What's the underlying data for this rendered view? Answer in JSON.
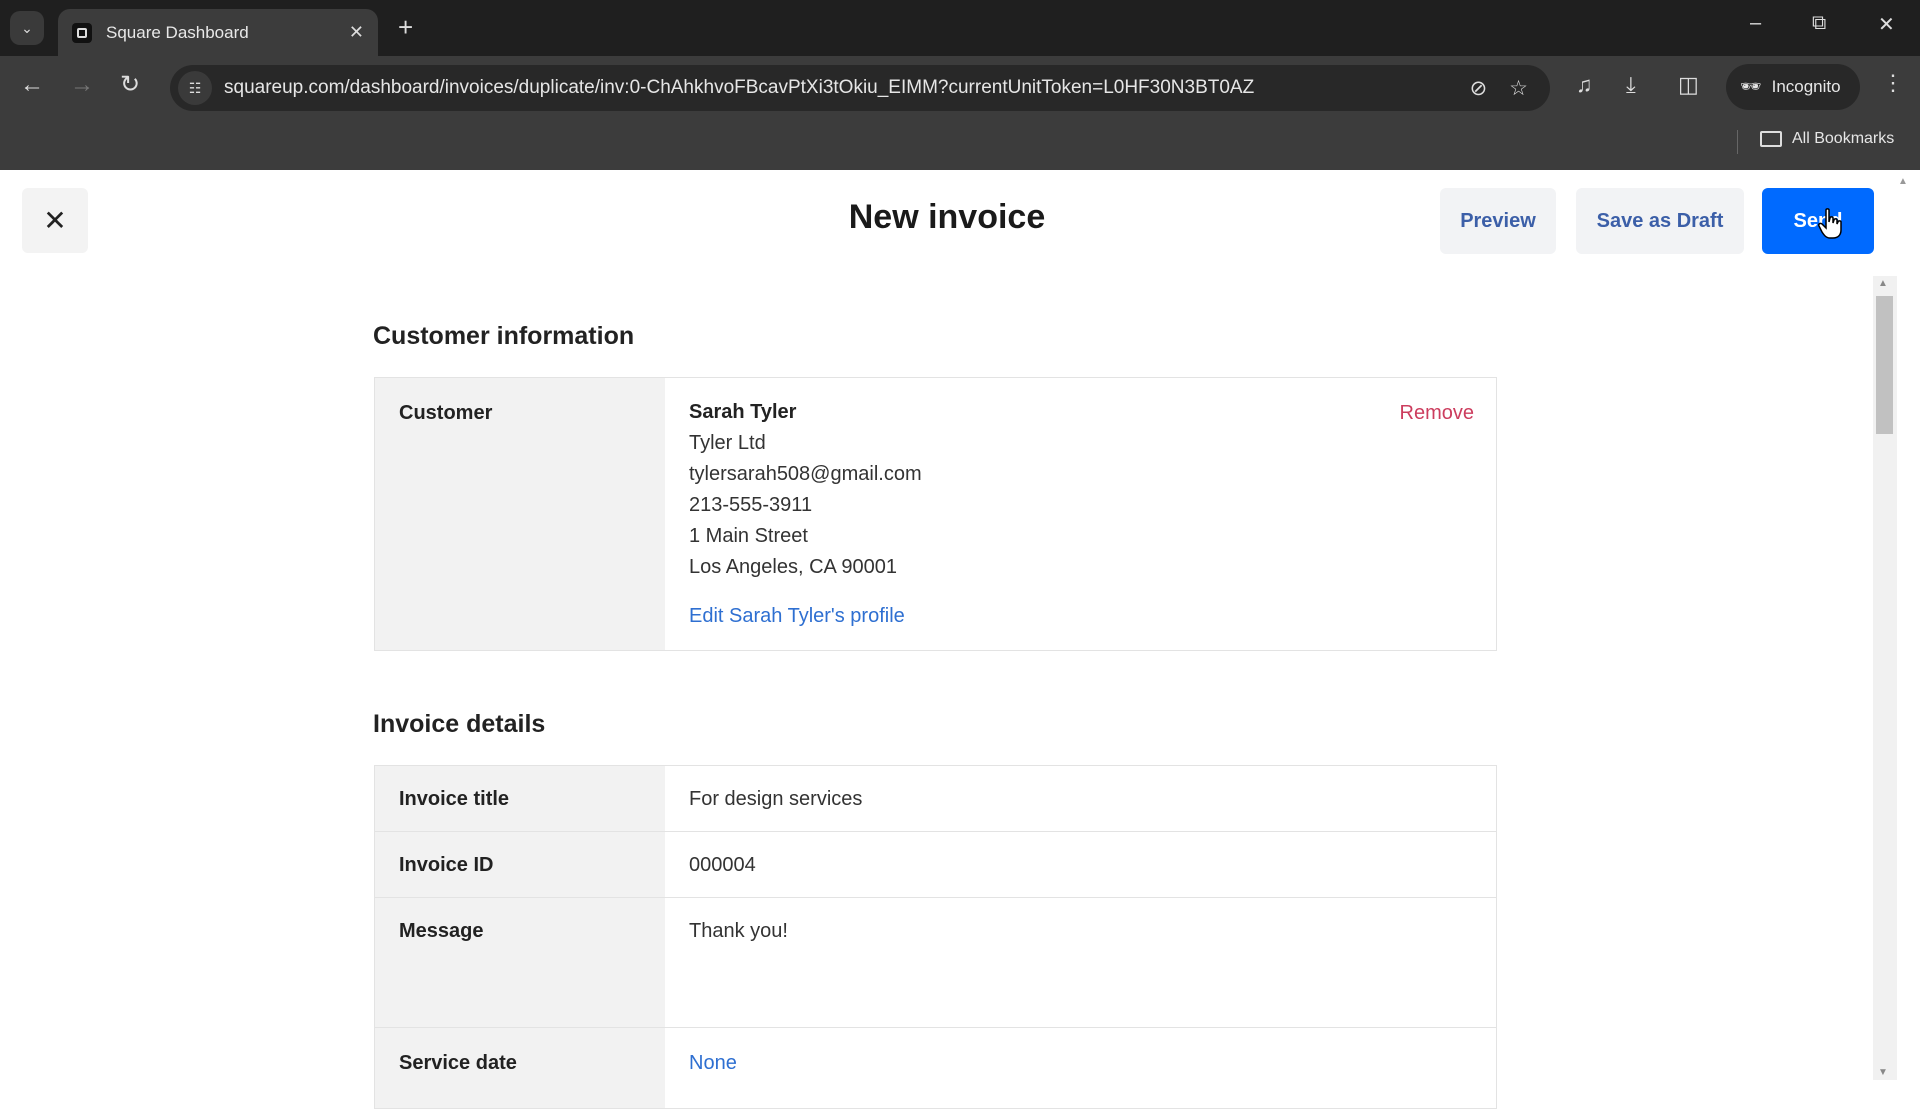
{
  "browser": {
    "tab_title": "Square Dashboard",
    "url": "squareup.com/dashboard/invoices/duplicate/inv:0-ChAhkhvoFBcavPtXi3tOkiu_EIMM?currentUnitToken=L0HF30N3BT0AZ",
    "incognito_label": "Incognito",
    "bookmarks_label": "All Bookmarks"
  },
  "header": {
    "title": "New invoice",
    "preview_label": "Preview",
    "save_draft_label": "Save as Draft",
    "send_label": "Send"
  },
  "customer_section": {
    "title": "Customer information",
    "label": "Customer",
    "name": "Sarah Tyler",
    "company": "Tyler Ltd",
    "email": "tylersarah508@gmail.com",
    "phone": "213-555-3911",
    "street": "1 Main Street",
    "city_line": "Los Angeles, CA 90001",
    "edit_link": "Edit Sarah Tyler's profile",
    "remove_label": "Remove"
  },
  "invoice_section": {
    "title": "Invoice details",
    "rows": [
      {
        "label": "Invoice title",
        "value": "For design services"
      },
      {
        "label": "Invoice ID",
        "value": "000004"
      },
      {
        "label": "Message",
        "value": "Thank you!"
      },
      {
        "label": "Service date",
        "value": "None"
      }
    ]
  },
  "colors": {
    "primary": "#006aff",
    "secondary_text": "#3c5fa8",
    "link": "#2e6fd1",
    "danger": "#cc3d5e"
  }
}
